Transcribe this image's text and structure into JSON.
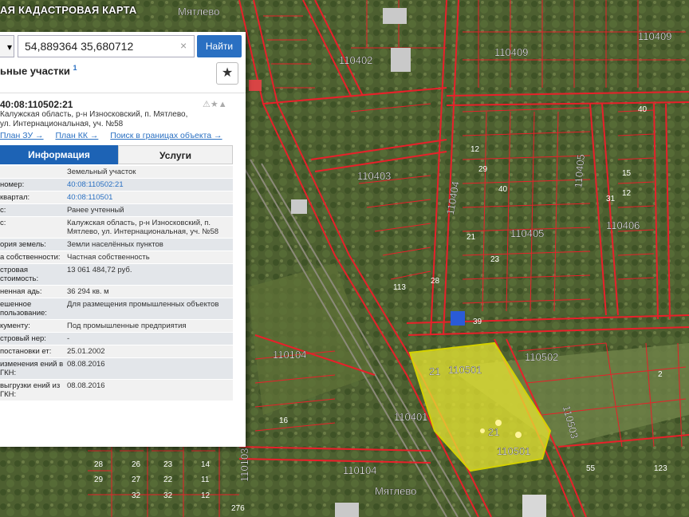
{
  "app": {
    "title": "АЯ КАДАСТРОВАЯ КАРТА"
  },
  "map": {
    "settlement": "Мятлево",
    "labels": [
      {
        "text": "Мятлево"
      },
      {
        "text": "110402"
      },
      {
        "text": "110409"
      },
      {
        "text": "110409"
      },
      {
        "text": "110403"
      },
      {
        "text": "110404"
      },
      {
        "text": "110405"
      },
      {
        "text": "110406"
      },
      {
        "text": "110104"
      },
      {
        "text": "110501"
      },
      {
        "text": "110502"
      },
      {
        "text": "110401"
      },
      {
        "text": "110501"
      },
      {
        "text": "110104"
      },
      {
        "text": "Мятлево"
      },
      {
        "text": "110503"
      },
      {
        "text": "110103"
      },
      {
        "text": "110405"
      },
      {
        "text": "21"
      },
      {
        "text": "21"
      }
    ],
    "highlight_color": "#e8e632",
    "boundary_color": "#e8202a"
  },
  "search": {
    "layer_label": "",
    "query": "54,889364 35,680712",
    "button": "Найти"
  },
  "panel": {
    "section_title": "ьные участки",
    "section_sup": "1",
    "star": "★",
    "card": {
      "number": "40:08:110502:21",
      "address_line1": "Калужская область, р-н Износковский, п. Мятлево,",
      "address_line2": "ул. Интернациональная, уч. №58",
      "icons": "⚠★▲",
      "links": [
        "План ЗУ →",
        "План КК →",
        "Поиск в границах объекта →"
      ]
    },
    "tabs": {
      "info": "Информация",
      "services": "Услуги"
    },
    "props": [
      {
        "k": "",
        "v": "Земельный участок"
      },
      {
        "k": "номер:",
        "v": "40:08:110502:21",
        "link": true
      },
      {
        "k": "квартал:",
        "v": "40:08:110501",
        "link": true
      },
      {
        "k": "с:",
        "v": "Ранее учтенный"
      },
      {
        "k": "с:",
        "v": "Калужская область, р-н Износковский, п. Мятлево, ул. Интернациональная, уч. №58"
      },
      {
        "k": "ория земель:",
        "v": "Земли населённых пунктов"
      },
      {
        "k": "а собственности:",
        "v": "Частная собственность"
      },
      {
        "k": "стровая стоимость:",
        "v": "13 061 484,72 руб."
      },
      {
        "k": "ненная адь:",
        "v": "36 294 кв. м"
      },
      {
        "k": "ешенное пользование:",
        "v": "Для размещения промышленных объектов"
      },
      {
        "k": "кументу:",
        "v": "Под промышленные предприятия"
      },
      {
        "k": "стровый нер:",
        "v": "-"
      },
      {
        "k": "постановки ет:",
        "v": "25.01.2002"
      },
      {
        "k": "изменения ений в ГКН:",
        "v": "08.08.2016"
      },
      {
        "k": "выгрузки ений из ГКН:",
        "v": "08.08.2016"
      }
    ]
  }
}
